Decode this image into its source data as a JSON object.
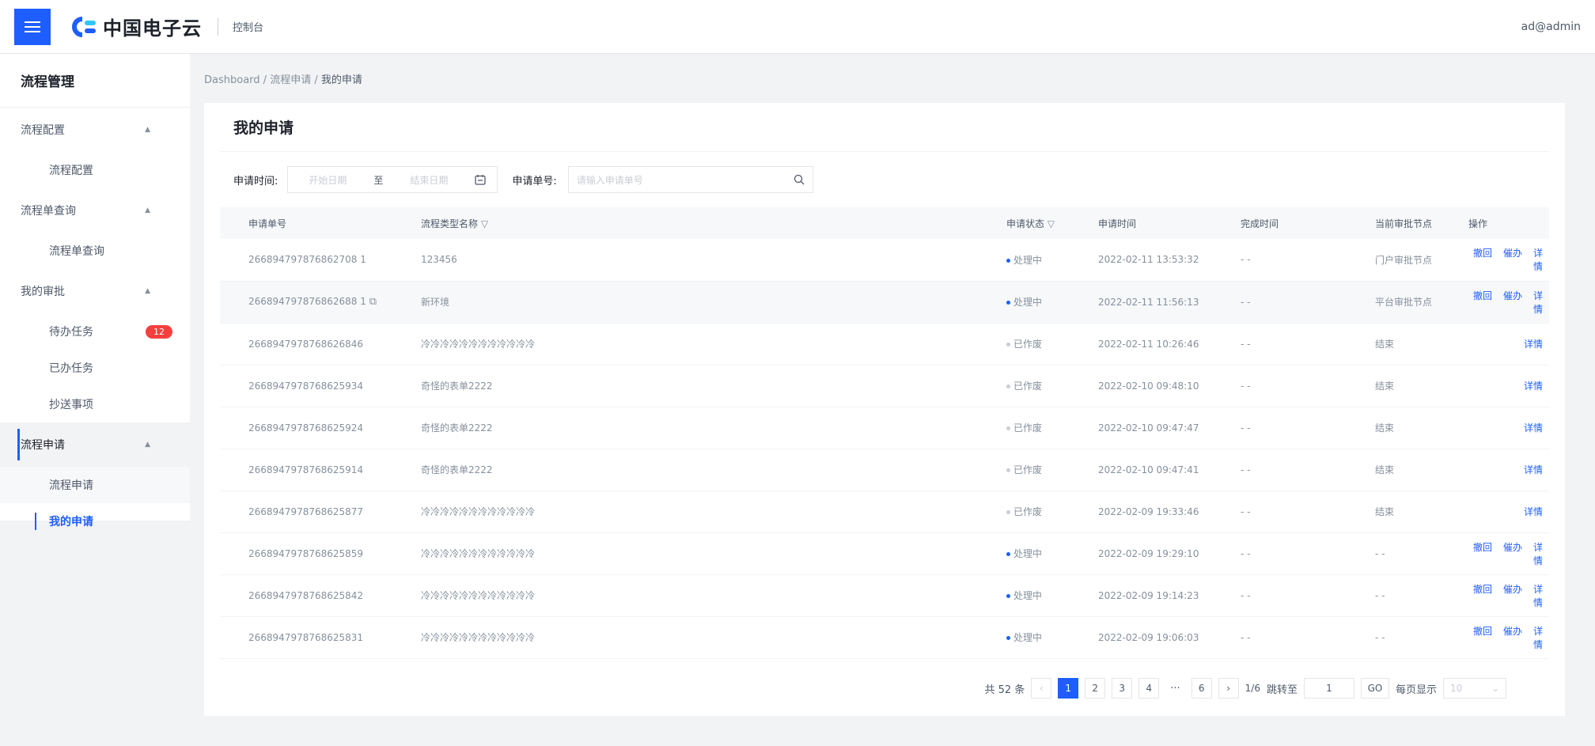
{
  "header": {
    "logo_text": "中国电子云",
    "console": "控制台",
    "user": "ad@admin"
  },
  "breadcrumb": {
    "items": [
      "Dashboard",
      "流程申请",
      "我的申请"
    ]
  },
  "sidebar": {
    "title": "流程管理",
    "groups": [
      {
        "label": "流程配置",
        "items": [
          "流程配置"
        ]
      },
      {
        "label": "流程单查询",
        "items": [
          "流程单查询"
        ]
      },
      {
        "label": "我的审批",
        "items": [
          "待办任务",
          "已办任务",
          "抄送事项"
        ],
        "badge": "12"
      },
      {
        "label": "流程申请",
        "items": [
          "流程申请",
          "我的申请"
        ]
      }
    ]
  },
  "page": {
    "title": "我的申请"
  },
  "filter": {
    "time_label": "申请时间:",
    "start_placeholder": "开始日期",
    "to": "至",
    "end_placeholder": "结束日期",
    "no_label": "申请单号:",
    "no_placeholder": "请输入申请单号"
  },
  "table": {
    "columns": [
      "申请单号",
      "流程类型名称",
      "申请状态",
      "申请时间",
      "完成时间",
      "当前审批节点",
      "操作"
    ],
    "ops": {
      "revoke": "撤回",
      "urge": "催办",
      "detail": "详情"
    },
    "rows": [
      {
        "id": "266894797876862708 1",
        "type": "123456",
        "status": "处理中",
        "time": "2022-02-11 13:53:32",
        "done": "- -",
        "node": "门户审批节点"
      },
      {
        "id": "266894797876862688 1",
        "type": "新环境",
        "status": "处理中",
        "time": "2022-02-11 11:56:13",
        "done": "- -",
        "node": "平台审批节点"
      },
      {
        "id": "2668947978768626846",
        "type": "冷冷冷冷冷冷冷冷冷冷冷冷",
        "status": "已作废",
        "time": "2022-02-11 10:26:46",
        "done": "- -",
        "node": "结束"
      },
      {
        "id": "2668947978768625934",
        "type": "奇怪的表单2222",
        "status": "已作废",
        "time": "2022-02-10 09:48:10",
        "done": "- -",
        "node": "结束"
      },
      {
        "id": "2668947978768625924",
        "type": "奇怪的表单2222",
        "status": "已作废",
        "time": "2022-02-10 09:47:47",
        "done": "- -",
        "node": "结束"
      },
      {
        "id": "2668947978768625914",
        "type": "奇怪的表单2222",
        "status": "已作废",
        "time": "2022-02-10 09:47:41",
        "done": "- -",
        "node": "结束"
      },
      {
        "id": "2668947978768625877",
        "type": "冷冷冷冷冷冷冷冷冷冷冷冷",
        "status": "已作废",
        "time": "2022-02-09 19:33:46",
        "done": "- -",
        "node": "结束"
      },
      {
        "id": "2668947978768625859",
        "type": "冷冷冷冷冷冷冷冷冷冷冷冷",
        "status": "处理中",
        "time": "2022-02-09 19:29:10",
        "done": "- -",
        "node": "- -"
      },
      {
        "id": "2668947978768625842",
        "type": "冷冷冷冷冷冷冷冷冷冷冷冷",
        "status": "处理中",
        "time": "2022-02-09 19:14:23",
        "done": "- -",
        "node": "- -"
      },
      {
        "id": "2668947978768625831",
        "type": "冷冷冷冷冷冷冷冷冷冷冷冷",
        "status": "处理中",
        "time": "2022-02-09 19:06:03",
        "done": "- -",
        "node": "- -"
      }
    ]
  },
  "pager": {
    "total": "共 52 条",
    "pages": [
      "1",
      "2",
      "3",
      "4",
      "···",
      "6"
    ],
    "page_info": "1/6",
    "jump_label": "跳转至",
    "jump_value": "1",
    "go": "GO",
    "size_label": "每页显示",
    "size_value": "10"
  },
  "colors": {
    "primary": "#1e5eff",
    "badge": "#f53f3f",
    "processing": "#1e5eff",
    "voided": "#c9cdd4"
  }
}
